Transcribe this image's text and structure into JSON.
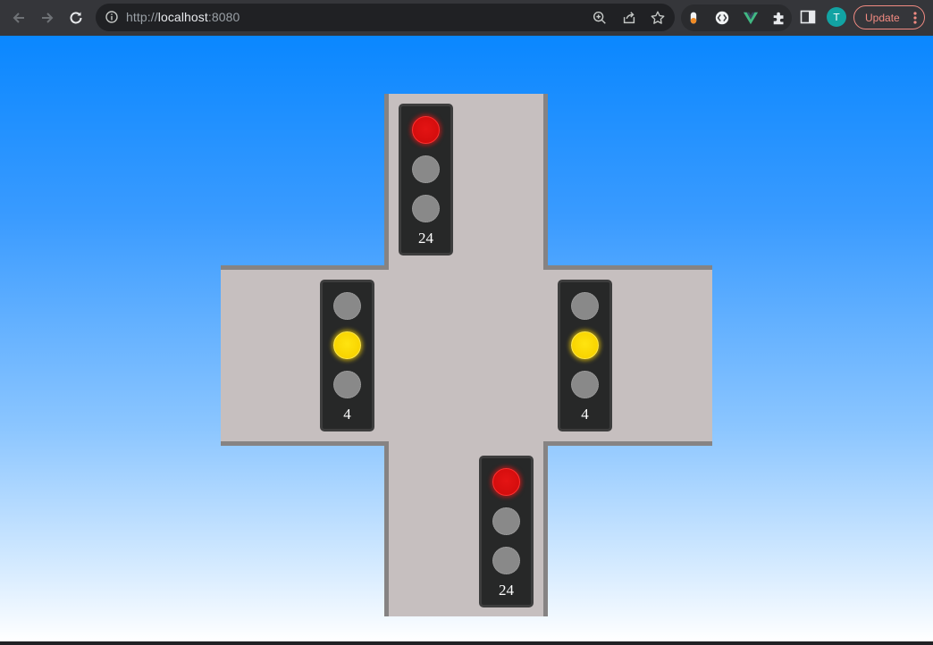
{
  "browser": {
    "url_scheme": "http://",
    "url_host": "localhost",
    "url_port": ":8080",
    "avatar_initial": "T",
    "update_label": "Update"
  },
  "icons": {
    "back": "arrow-left-icon",
    "forward": "arrow-right-icon",
    "reload": "reload-icon",
    "site_info": "info-icon",
    "zoom": "zoom-in-icon",
    "share": "share-icon",
    "bookmark": "star-icon",
    "extensions": [
      "pill-extension-icon",
      "code-extension-icon",
      "vue-devtools-icon",
      "puzzle-extensions-icon"
    ],
    "side_panel": "side-panel-icon",
    "menu": "kebab-menu-icon"
  },
  "colors": {
    "road": "#c6bfbf",
    "curb": "#868383",
    "sky_top": "#0a87ff",
    "sky_bottom": "#ffffff",
    "red_light": "#d40d0d",
    "yellow_light": "#f8d400",
    "off_light": "#898989",
    "accent_update": "#f28b82"
  },
  "traffic_lights": {
    "north": {
      "active": "red",
      "countdown": "24"
    },
    "west": {
      "active": "yellow",
      "countdown": "4"
    },
    "east": {
      "active": "yellow",
      "countdown": "4"
    },
    "south": {
      "active": "red",
      "countdown": "24"
    }
  }
}
